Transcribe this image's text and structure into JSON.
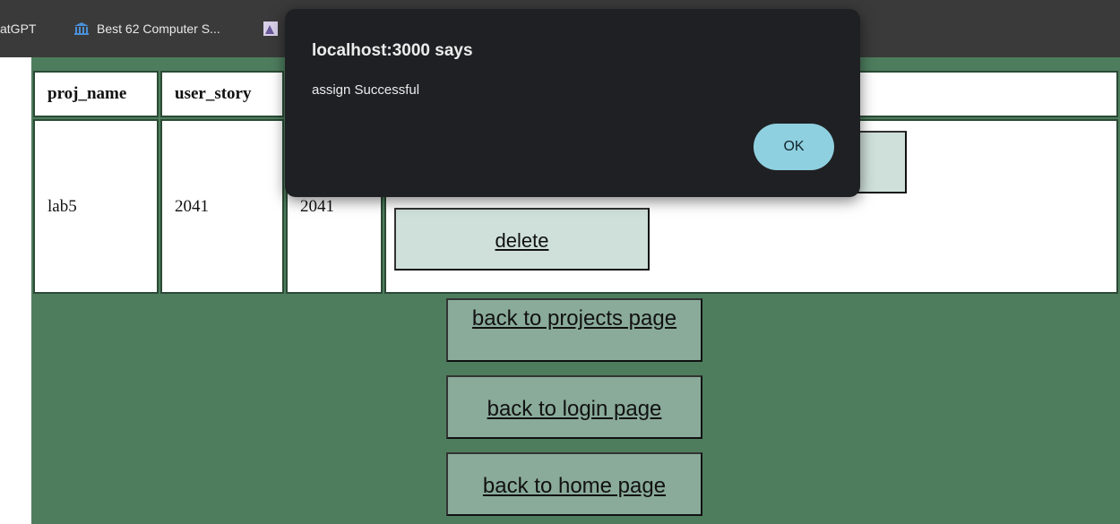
{
  "bookmarks": [
    {
      "label": "atGPT",
      "icon": ""
    },
    {
      "label": "Best 62 Computer S...",
      "icon": "bank-icon"
    },
    {
      "label": "",
      "icon": "image-icon"
    }
  ],
  "table": {
    "headers": [
      "proj_name",
      "user_story",
      "",
      ""
    ],
    "rows": [
      {
        "proj_name": "lab5",
        "user_story": "2041",
        "col3": "2041"
      }
    ]
  },
  "actions": {
    "delete_label": "delete"
  },
  "nav": {
    "projects_label": "back to projects page",
    "login_label": "back to login page",
    "home_label": "back to home page"
  },
  "dialog": {
    "title": "localhost:3000 says",
    "message": "assign Successful",
    "ok_label": "OK"
  },
  "colors": {
    "page_bg": "#4e7d5e",
    "button_bg": "#cfe0da",
    "nav_button_bg": "#8aab9a",
    "dialog_bg": "#1f2023",
    "ok_button_bg": "#8fd0e0"
  }
}
